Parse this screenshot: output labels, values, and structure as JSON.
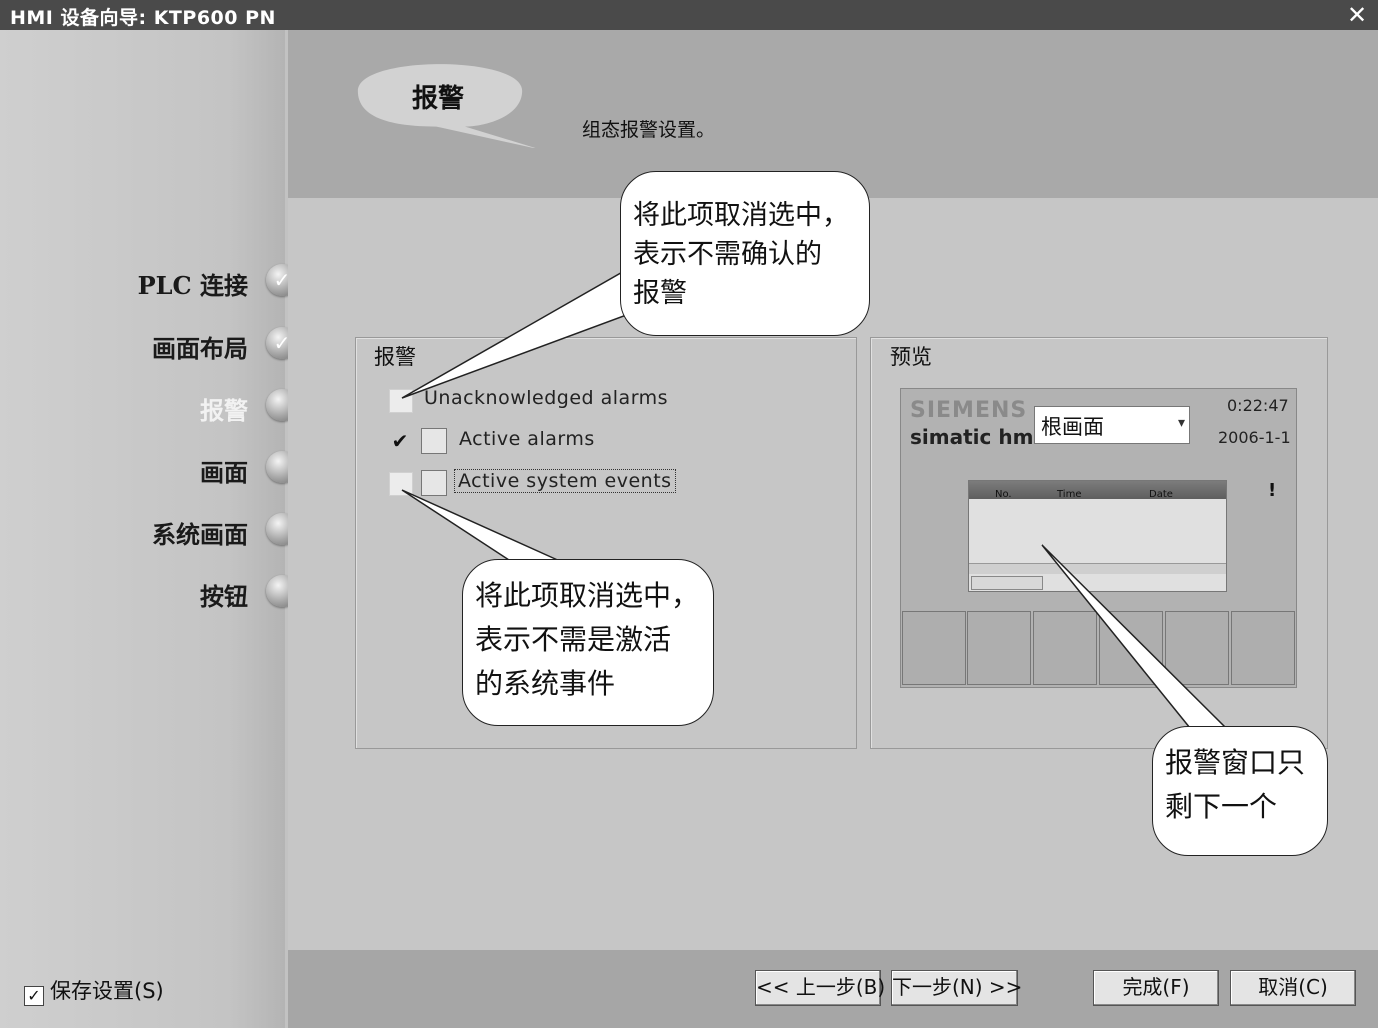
{
  "window": {
    "title": "HMI 设备向导: KTP600 PN"
  },
  "steps": [
    {
      "label": "PLC 连接",
      "state": "done"
    },
    {
      "label": "画面布局",
      "state": "done"
    },
    {
      "label": "报警",
      "state": "active"
    },
    {
      "label": "画面",
      "state": "pending"
    },
    {
      "label": "系统画面",
      "state": "pending"
    },
    {
      "label": "按钮",
      "state": "pending"
    }
  ],
  "header": {
    "title": "报警",
    "description": "组态报警设置。"
  },
  "alarm_group": {
    "title": "报警",
    "options": [
      {
        "label": "Unacknowledged alarms",
        "checked": false
      },
      {
        "label": "Active alarms",
        "checked": true
      },
      {
        "label": "Active system events",
        "checked": false
      }
    ]
  },
  "preview": {
    "title": "预览",
    "brand": "SIEMENS",
    "product": "simatic hmi",
    "screen_select": "根画面",
    "time": "0:22:47",
    "date": "2006-1-1",
    "warning": "!",
    "columns": [
      "No.",
      "Time",
      "Date"
    ]
  },
  "callouts": {
    "c1": [
      "将此项取消选中，",
      "表示不需确认的",
      "报警"
    ],
    "c2": [
      "将此项取消选中，",
      "表示不需是激活",
      "的系统事件"
    ],
    "c3": [
      "报警窗口只",
      "剩下一个"
    ]
  },
  "footer": {
    "save_settings": "保存设置(S)",
    "back": "<< 上一步(B)",
    "next": "下一步(N) >>",
    "finish": "完成(F)",
    "cancel": "取消(C)"
  },
  "colors": {
    "title_bar": "#4a4a4a",
    "header_band": "#a9a9a9",
    "content": "#c6c6c6"
  }
}
